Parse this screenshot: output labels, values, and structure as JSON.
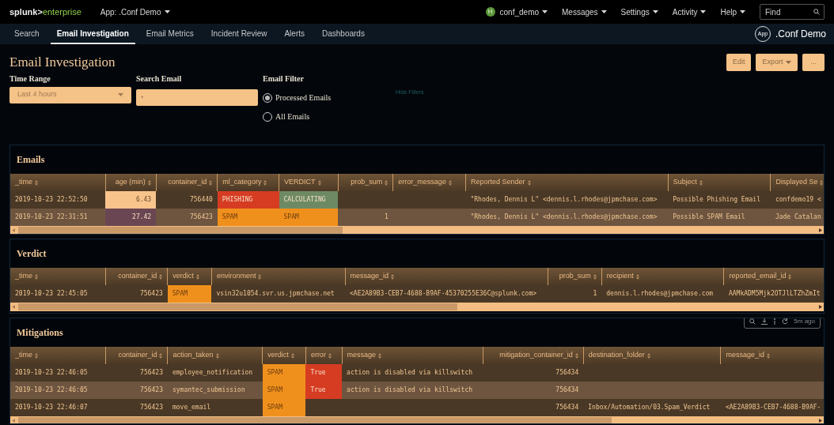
{
  "topbar": {
    "logo_brand": "splunk>",
    "logo_product": "enterprise",
    "app_menu": "App: .Conf Demo",
    "user_initial": "H",
    "menus": [
      {
        "label": "conf_demo"
      },
      {
        "label": "Messages"
      },
      {
        "label": "Settings"
      },
      {
        "label": "Activity"
      },
      {
        "label": "Help"
      }
    ],
    "find_placeholder": "Find"
  },
  "nav": {
    "tabs": [
      {
        "label": "Search",
        "selected": false
      },
      {
        "label": "Email Investigation",
        "selected": true
      },
      {
        "label": "Email Metrics",
        "selected": false
      },
      {
        "label": "Incident Review",
        "selected": false
      },
      {
        "label": "Alerts",
        "selected": false
      },
      {
        "label": "Dashboards",
        "selected": false
      }
    ],
    "app_badge": "App",
    "app_name": ".Conf Demo"
  },
  "dashboard": {
    "title": "Email Investigation",
    "buttons": [
      {
        "label": "Edit",
        "kind": "plain"
      },
      {
        "label": "Export",
        "kind": "menu"
      },
      {
        "label": "...",
        "kind": "plain"
      }
    ],
    "filters": {
      "time_range": {
        "label": "Time Range",
        "value": "Last 4 hours"
      },
      "search_email": {
        "label": "Search Email",
        "value": "*"
      },
      "email_filter": {
        "label": "Email Filter",
        "options": [
          {
            "label": "Processed Emails",
            "selected": true
          },
          {
            "label": "All Emails",
            "selected": false
          }
        ]
      },
      "hide_filters": "Hide Filters"
    }
  },
  "panels": [
    {
      "title": "Emails",
      "columns": [
        "_time",
        "age (min)",
        "container_id",
        "ml_category",
        "VERDICT",
        "prob_sum",
        "error_message",
        "Reported Sender",
        "Subject",
        "Displayed Se"
      ],
      "rows": [
        [
          {
            "text": "2019-10-23 22:52:50"
          },
          {
            "text": "6.43",
            "color": "#f8c48c"
          },
          {
            "text": "756440"
          },
          {
            "text": "PHISHING",
            "color": "#d63c22"
          },
          {
            "text": "CALCULATING",
            "color": "#6e8a64"
          },
          {
            "text": ""
          },
          {
            "text": ""
          },
          {
            "text": "\"Rhodes, Dennis L\" <dennis.l.rhodes@jpmchase.com>"
          },
          {
            "text": "Possible Phishing Email"
          },
          {
            "text": "confdemo19 <"
          }
        ],
        [
          {
            "text": "2019-10-23 22:31:51"
          },
          {
            "text": "27.42",
            "color": "#6a4652"
          },
          {
            "text": "756423"
          },
          {
            "text": "SPAM",
            "color": "#f0901c"
          },
          {
            "text": "SPAM",
            "color": "#f0901c"
          },
          {
            "text": "1"
          },
          {
            "text": ""
          },
          {
            "text": "\"Rhodes, Dennis L\" <dennis.l.rhodes@jpmchase.com>"
          },
          {
            "text": "Possible SPAM Email"
          },
          {
            "text": "Jade Catalan"
          }
        ]
      ]
    },
    {
      "title": "Verdict",
      "columns": [
        "_time",
        "container_id",
        "verdict",
        "environment",
        "message_id",
        "prob_sum",
        "recipient",
        "reported_email_id"
      ],
      "rows": [
        [
          {
            "text": "2019-10-23 22:45:05"
          },
          {
            "text": "756423"
          },
          {
            "text": "SPAM",
            "color": "#f0901c"
          },
          {
            "text": "vsin32u1054.svr.us.jpmchase.net"
          },
          {
            "text": "<AE2A89B3-CEB7-4688-B9AF-45370255E36C@splunk.com>"
          },
          {
            "text": "1"
          },
          {
            "text": "dennis.l.rhodes@jpmchase.com"
          },
          {
            "text": "AAMkADM5Mjk2OTJlLTZhZmIt"
          }
        ]
      ]
    },
    {
      "title": "Mitigations",
      "toolbar_time": "5m ago",
      "columns": [
        "_time",
        "container_id",
        "action_taken",
        "verdict",
        "error",
        "message",
        "mitigation_container_id",
        "destination_folder",
        "message_id"
      ],
      "rows": [
        [
          {
            "text": "2019-10-23 22:46:05"
          },
          {
            "text": "756423"
          },
          {
            "text": "employee_notification"
          },
          {
            "text": "SPAM",
            "color": "#f0901c"
          },
          {
            "text": "True",
            "color": "#d63c22"
          },
          {
            "text": "action is disabled via killswitch"
          },
          {
            "text": "756434"
          },
          {
            "text": ""
          },
          {
            "text": ""
          }
        ],
        [
          {
            "text": "2019-10-23 22:46:05"
          },
          {
            "text": "756423"
          },
          {
            "text": "symantec_submission"
          },
          {
            "text": "SPAM",
            "color": "#f0901c"
          },
          {
            "text": "True",
            "color": "#d63c22"
          },
          {
            "text": "action is disabled via killswitch"
          },
          {
            "text": "756434"
          },
          {
            "text": ""
          },
          {
            "text": ""
          }
        ],
        [
          {
            "text": "2019-10-23 22:46:07"
          },
          {
            "text": "756423"
          },
          {
            "text": "move_email"
          },
          {
            "text": "SPAM",
            "color": "#f0901c"
          },
          {
            "text": ""
          },
          {
            "text": ""
          },
          {
            "text": "756434"
          },
          {
            "text": "Inbox/Automation/03.Spam_Verdict"
          },
          {
            "text": "<AE2A89B3-CEB7-4688-B9AF-"
          }
        ]
      ]
    }
  ]
}
